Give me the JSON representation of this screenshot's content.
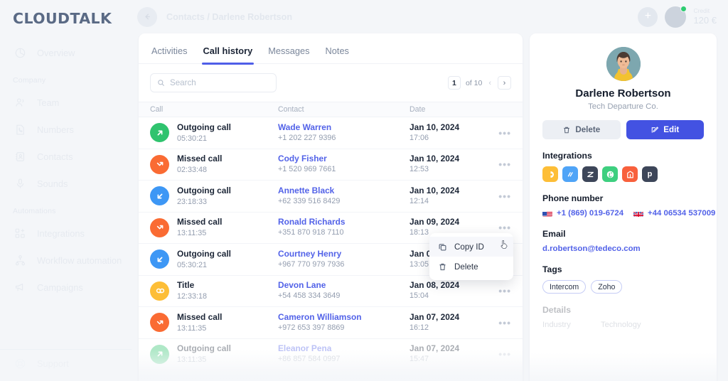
{
  "brand": {
    "logo": "CLOUDTALK",
    "accent": "#4f5ee8",
    "link": "#5262e8"
  },
  "topbar": {
    "breadcrumb": "Contacts / Darlene Robertson",
    "add_label": "+",
    "credit_label": "Credit",
    "credit_value": "120 €"
  },
  "sidebar": {
    "items": [
      {
        "label": "Overview",
        "icon": "pie-chart-icon"
      }
    ],
    "groups": [
      {
        "label": "Company",
        "items": [
          {
            "label": "Team",
            "icon": "users-icon"
          },
          {
            "label": "Numbers",
            "icon": "file-phone-icon"
          },
          {
            "label": "Contacts",
            "icon": "contact-card-icon"
          },
          {
            "label": "Sounds",
            "icon": "microphone-icon"
          }
        ]
      },
      {
        "label": "Automations",
        "items": [
          {
            "label": "Integrations",
            "icon": "grid-plus-icon"
          },
          {
            "label": "Workflow automation",
            "icon": "sitemap-icon"
          },
          {
            "label": "Campaigns",
            "icon": "megaphone-icon"
          }
        ]
      }
    ],
    "bottom": {
      "label": "Support",
      "icon": "lifebuoy-icon"
    }
  },
  "main": {
    "tabs": [
      {
        "label": "Activities",
        "active": false
      },
      {
        "label": "Call history",
        "active": true
      },
      {
        "label": "Messages",
        "active": false
      },
      {
        "label": "Notes",
        "active": false
      }
    ],
    "search": {
      "placeholder": "Search",
      "value": ""
    },
    "pager": {
      "page": "1",
      "of": "of 10",
      "prev": "‹",
      "next": "›"
    },
    "table": {
      "headers": {
        "call": "Call",
        "contact": "Contact",
        "date": "Date"
      },
      "rows": [
        {
          "type": "Outgoing call",
          "duration": "05:30:21",
          "icon": "arrow-up-right-icon",
          "color": "#2fc36e",
          "contact": "Wade Warren",
          "phone": "+1 202 227 9396",
          "date": "Jan 10, 2024",
          "time": "17:06",
          "faded": false
        },
        {
          "type": "Missed call",
          "duration": "02:33:48",
          "icon": "arrow-missed-icon",
          "color": "#fa6b33",
          "contact": "Cody Fisher",
          "phone": "+1 520 969 7661",
          "date": "Jan 10, 2024",
          "time": "12:53",
          "faded": false
        },
        {
          "type": "Outgoing call",
          "duration": "23:18:33",
          "icon": "arrow-down-left-icon",
          "color": "#3d97f5",
          "contact": "Annette Black",
          "phone": "+62 339 516 8429",
          "date": "Jan 10, 2024",
          "time": "12:14",
          "faded": false
        },
        {
          "type": "Missed call",
          "duration": "13:11:35",
          "icon": "arrow-missed-icon",
          "color": "#fa6b33",
          "contact": "Ronald Richards",
          "phone": "+351 870 918 7110",
          "date": "Jan 09, 2024",
          "time": "18:13",
          "faded": false
        },
        {
          "type": "Outgoing call",
          "duration": "05:30:21",
          "icon": "arrow-down-left-icon",
          "color": "#3d97f5",
          "contact": "Courtney Henry",
          "phone": "+967 770 979 7936",
          "date": "Jan 09, 2024",
          "time": "13:05",
          "faded": false
        },
        {
          "type": "Title",
          "duration": "12:33:18",
          "icon": "voicemail-icon",
          "color": "#fdbe37",
          "contact": "Devon Lane",
          "phone": "+54 458 334 3649",
          "date": "Jan 08, 2024",
          "time": "15:04",
          "faded": false
        },
        {
          "type": "Missed call",
          "duration": "13:11:35",
          "icon": "arrow-missed-icon",
          "color": "#fa6b33",
          "contact": "Cameron Williamson",
          "phone": "+972 653 397 8869",
          "date": "Jan 07, 2024",
          "time": "16:12",
          "faded": false
        },
        {
          "type": "Outgoing call",
          "duration": "13:11:35",
          "icon": "arrow-up-right-icon",
          "color": "#2fc36e",
          "contact": "Eleanor Pena",
          "phone": "+86 857 584 0997",
          "date": "Jan 07, 2024",
          "time": "15:47",
          "faded": true
        }
      ],
      "row_action_label": "•••"
    },
    "context_menu": {
      "items": [
        {
          "label": "Copy ID",
          "icon": "copy-icon",
          "hover": true
        },
        {
          "label": "Delete",
          "icon": "trash-icon",
          "hover": false
        }
      ]
    }
  },
  "detail_panel": {
    "name": "Darlene Robertson",
    "company": "Tech Departure Co.",
    "delete_label": "Delete",
    "edit_label": "Edit",
    "integrations_title": "Integrations",
    "integrations": [
      {
        "name": "intercom-icon",
        "bg": "#fdbe37"
      },
      {
        "name": "slack-stripes-icon",
        "bg": "#4fa4f7"
      },
      {
        "name": "zendesk-icon",
        "bg": "#3d4659"
      },
      {
        "name": "hubspot-icon",
        "bg": "#3ecf7f"
      },
      {
        "name": "magento-icon",
        "bg": "#f8603c"
      },
      {
        "name": "pipedrive-icon",
        "bg": "#3d4659"
      }
    ],
    "phone_title": "Phone number",
    "phones": [
      {
        "flag": "us-flag-icon",
        "number": "+1 (869) 019-6724"
      },
      {
        "flag": "gb-flag-icon",
        "number": "+44 06534 537009"
      }
    ],
    "email_title": "Email",
    "email": "d.robertson@tedeco.com",
    "tags_title": "Tags",
    "tags": [
      "Intercom",
      "Zoho"
    ],
    "details_title": "Details",
    "details": [
      {
        "key": "Industry",
        "value": "Technology"
      }
    ]
  }
}
